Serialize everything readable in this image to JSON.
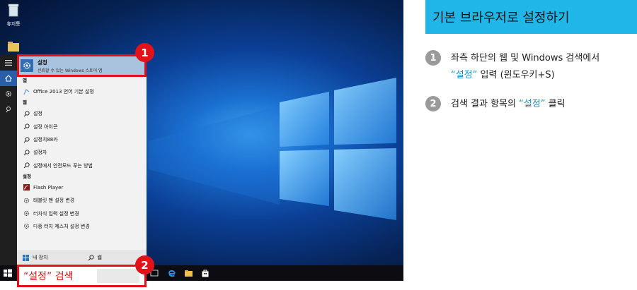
{
  "desktop": {
    "icons": [
      {
        "label": "휴지통"
      },
      {
        "label": ""
      }
    ]
  },
  "start_menu": {
    "best_match": {
      "title": "설정",
      "subtitle": "신뢰할 수 있는 Windows 스토어 앱"
    },
    "sections": {
      "apps": "앱",
      "web": "웹",
      "settings": "설정"
    },
    "apps": [
      {
        "label": "Office 2013 언어 기본 설정"
      }
    ],
    "web": [
      {
        "label": "설정"
      },
      {
        "label": "설정 아이콘"
      },
      {
        "label": "설정치88카"
      },
      {
        "label": "설정자"
      },
      {
        "label": "설정에서 안전모드 푸는 방법"
      }
    ],
    "settings": [
      {
        "label": "Flash Player"
      },
      {
        "label": "태블릿 펜 설정 변경"
      },
      {
        "label": "터치식 입력 설정 변경"
      },
      {
        "label": "다중 터치 제스처 설정 변경"
      }
    ],
    "bottom": {
      "my_device": "내 장치",
      "web": "웹"
    }
  },
  "search": {
    "query": "“설정” 검색"
  },
  "badges": {
    "one": "1",
    "two": "2"
  },
  "instructions": {
    "title": "기본 브라우저로 설정하기",
    "steps": [
      {
        "num": "1",
        "line1": "좌측 하단의 웹 및 Windows 검색에서",
        "line2_highlight": "“설정”",
        "line2_rest": " 입력 (윈도우키+S)"
      },
      {
        "num": "2",
        "prefix": "검색 결과 항목의 ",
        "highlight": "“설정”",
        "suffix": " 클릭"
      }
    ]
  },
  "colors": {
    "accent_red": "#e3121a",
    "title_band": "#20b7e8",
    "highlight_blue": "#1a8fd6",
    "best_match_bg": "#a9c3df"
  }
}
